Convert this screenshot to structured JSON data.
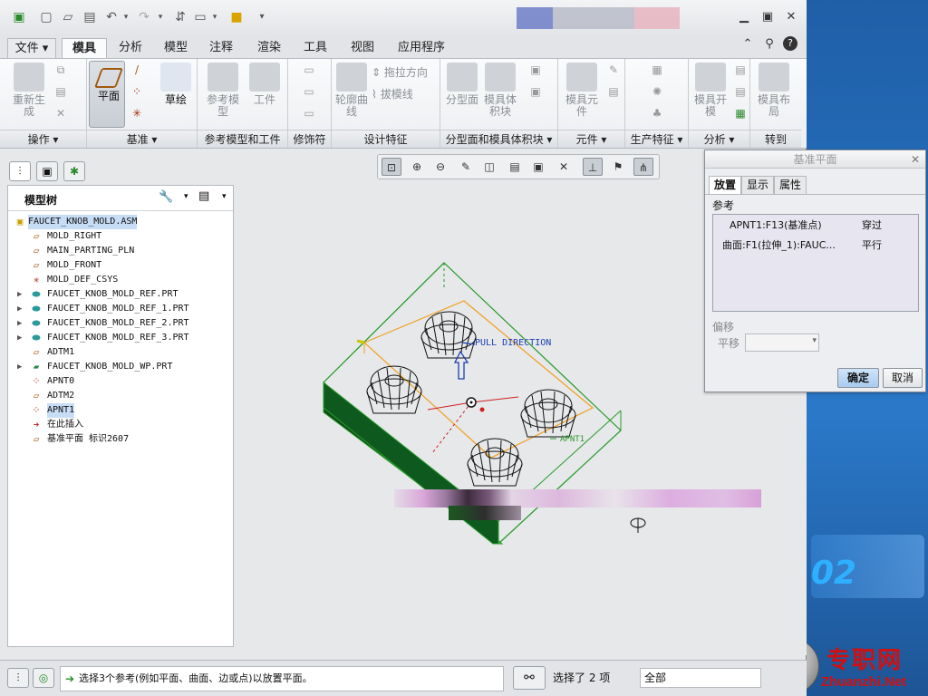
{
  "watermark": {
    "number": "02",
    "cn": "专职网",
    "en": "Zhuanzhi.Net"
  },
  "ribbon_tabs": [
    {
      "label": "文件 ▾",
      "active": false
    },
    {
      "label": "模具",
      "active": true
    },
    {
      "label": "分析",
      "active": false
    },
    {
      "label": "模型",
      "active": false
    },
    {
      "label": "注释",
      "active": false
    },
    {
      "label": "渲染",
      "active": false
    },
    {
      "label": "工具",
      "active": false
    },
    {
      "label": "视图",
      "active": false
    },
    {
      "label": "应用程序",
      "active": false
    }
  ],
  "ribbon_groups": {
    "operations": "操作 ▾",
    "datum": "基准 ▾",
    "reference_model": "参考模型和工件",
    "modifiers": "修饰符",
    "design_features": "设计特征",
    "parting": "分型面和模具体积块 ▾",
    "components": "元件 ▾",
    "production": "生产特征 ▾",
    "analysis": "分析 ▾",
    "goto": "转到"
  },
  "ribbon_buttons": {
    "regenerate": "重新生成",
    "plane": "平面",
    "sketch": "草绘",
    "ref_model": "参考模型",
    "workpiece": "工件",
    "profile_curve": "轮廓曲线",
    "drag_direction": "拖拉方向",
    "draft_line": "拔模线",
    "parting_surface": "分型面",
    "mold_volume": "模具体积块",
    "mold_component": "模具元件",
    "mold_open": "模具开模",
    "mold_layout": "模具布局"
  },
  "model_tree": {
    "title": "模型树",
    "items": [
      {
        "label": "FAUCET_KNOB_MOLD.ASM",
        "icon": "assembly-icon",
        "expandable": false,
        "selected": true
      },
      {
        "label": "MOLD_RIGHT",
        "icon": "datum-plane-icon",
        "expandable": false,
        "selected": false
      },
      {
        "label": "MAIN_PARTING_PLN",
        "icon": "datum-plane-icon",
        "expandable": false,
        "selected": false
      },
      {
        "label": "MOLD_FRONT",
        "icon": "datum-plane-icon",
        "expandable": false,
        "selected": false
      },
      {
        "label": "MOLD_DEF_CSYS",
        "icon": "csys-icon",
        "expandable": false,
        "selected": false
      },
      {
        "label": "FAUCET_KNOB_MOLD_REF.PRT",
        "icon": "part-icon",
        "expandable": true,
        "selected": false
      },
      {
        "label": "FAUCET_KNOB_MOLD_REF_1.PRT",
        "icon": "part-icon",
        "expandable": true,
        "selected": false
      },
      {
        "label": "FAUCET_KNOB_MOLD_REF_2.PRT",
        "icon": "part-icon",
        "expandable": true,
        "selected": false
      },
      {
        "label": "FAUCET_KNOB_MOLD_REF_3.PRT",
        "icon": "part-icon",
        "expandable": true,
        "selected": false
      },
      {
        "label": "ADTM1",
        "icon": "datum-plane-icon",
        "expandable": false,
        "selected": false
      },
      {
        "label": "FAUCET_KNOB_MOLD_WP.PRT",
        "icon": "workpiece-icon",
        "expandable": true,
        "selected": false
      },
      {
        "label": "APNT0",
        "icon": "datum-point-icon",
        "expandable": false,
        "selected": false
      },
      {
        "label": "ADTM2",
        "icon": "datum-plane-icon",
        "expandable": false,
        "selected": false
      },
      {
        "label": "APNT1",
        "icon": "datum-point-icon",
        "expandable": false,
        "selected": true
      },
      {
        "label": "在此插入",
        "icon": "insert-arrow-icon",
        "expandable": false,
        "selected": false
      },
      {
        "label": "基准平面 标识2607",
        "icon": "datum-plane-icon",
        "expandable": false,
        "selected": false
      }
    ]
  },
  "graphics": {
    "pull_direction": "PULL DIRECTION",
    "point_label": "APNT1"
  },
  "datum_dialog": {
    "title": "基准平面",
    "tabs": [
      "放置",
      "显示",
      "属性"
    ],
    "references_label": "参考",
    "references": [
      {
        "ref": "APNT1:F13(基准点)",
        "constraint": "穿过"
      },
      {
        "ref": "曲面:F1(拉伸_1):FAUC...",
        "constraint": "平行"
      }
    ],
    "offset_label": "偏移",
    "translate_label": "平移",
    "ok": "确定",
    "cancel": "取消"
  },
  "status_bar": {
    "message": "选择3个参考(例如平面、曲面、边或点)以放置平面。",
    "selection": "选择了 2 项",
    "filter": "全部"
  },
  "colors": {
    "workpiece": "#2a9a2a",
    "parting": "#f0a020",
    "accent_blue": "#1c4fa0"
  }
}
